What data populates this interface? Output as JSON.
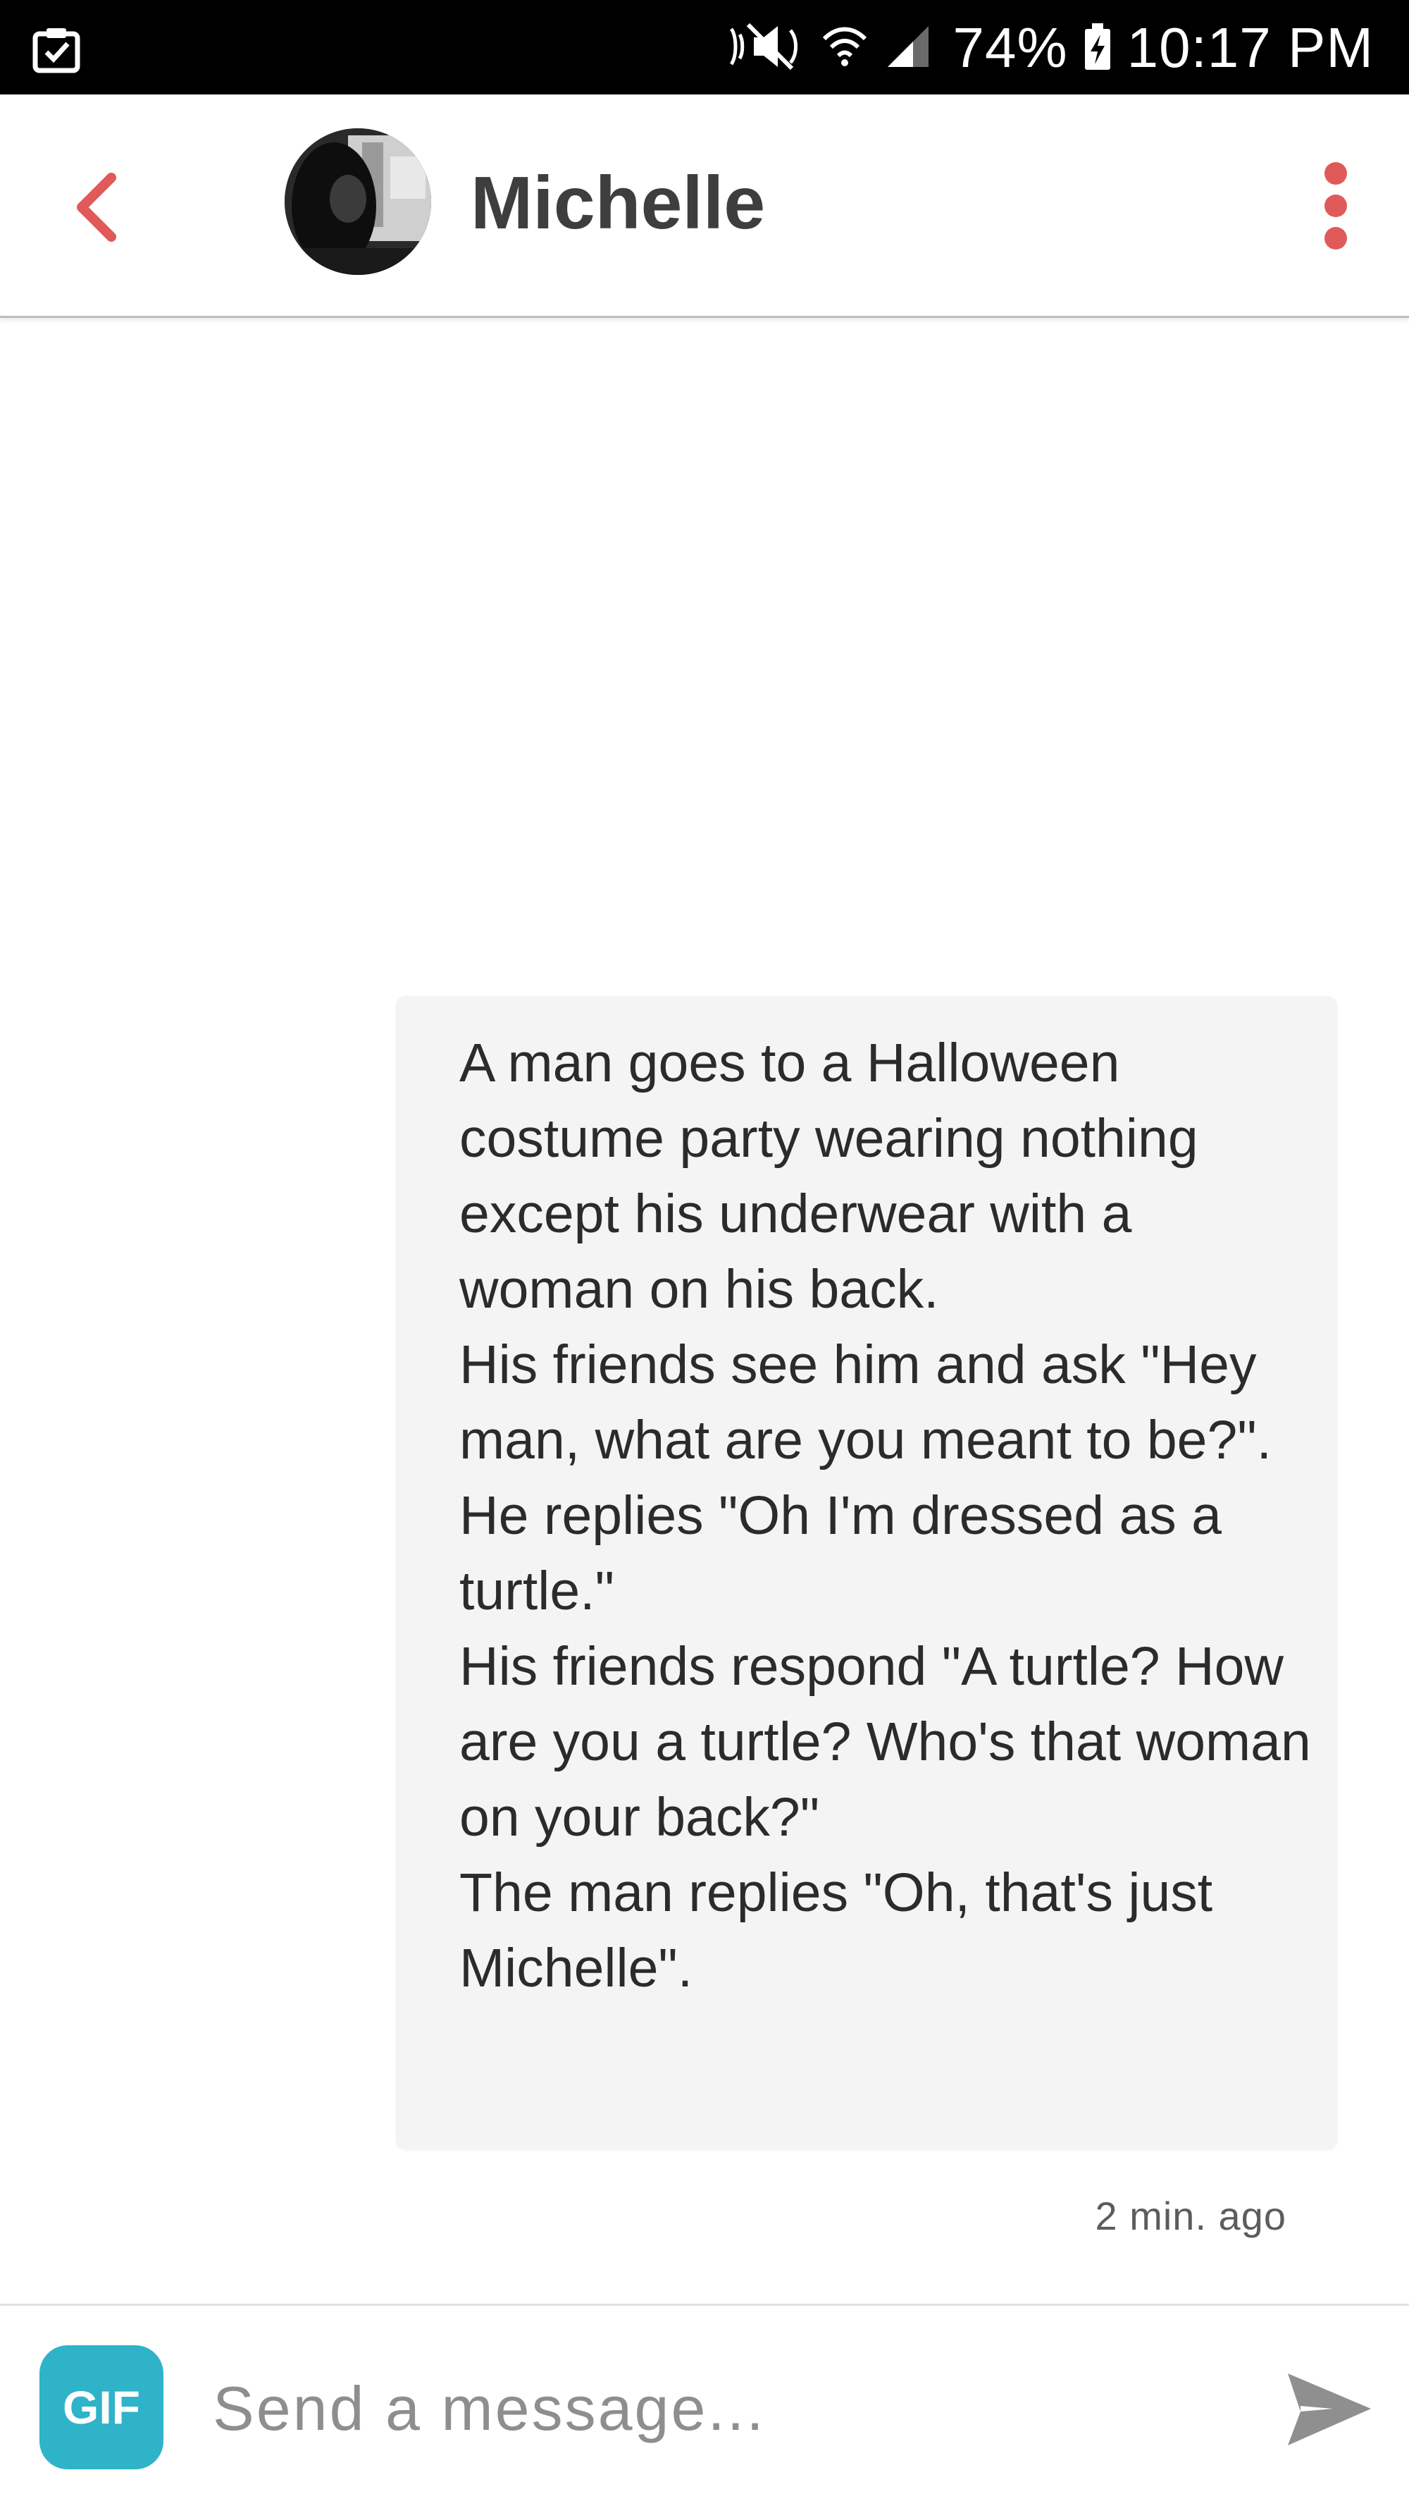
{
  "status_bar": {
    "left_icon": "clipboard-check-icon",
    "icons": [
      "mute-icon",
      "wifi-icon",
      "signal-icon"
    ],
    "battery_percent": "74%",
    "battery_icon": "battery-charging-icon",
    "time": "10:17 PM"
  },
  "header": {
    "back_icon": "chevron-left-icon",
    "contact_name": "Michelle",
    "menu_icon": "more-vertical-icon",
    "accent_color": "#e05a5a"
  },
  "messages": [
    {
      "text": "A man goes to a Halloween costume party wearing nothing except his underwear with a woman on his back.\nHis friends see him and ask \"Hey man, what are you meant to be?\".\nHe replies \"Oh I'm dressed as a turtle.\"\nHis friends respond \"A turtle? How are you a turtle? Who's that woman on your back?\"\nThe man replies \"Oh, that's just Michelle\".",
      "timestamp": "2 min. ago"
    }
  ],
  "composer": {
    "gif_label": "GIF",
    "placeholder": "Send a message...",
    "send_icon": "send-icon",
    "gif_color": "#2fb3c9"
  }
}
